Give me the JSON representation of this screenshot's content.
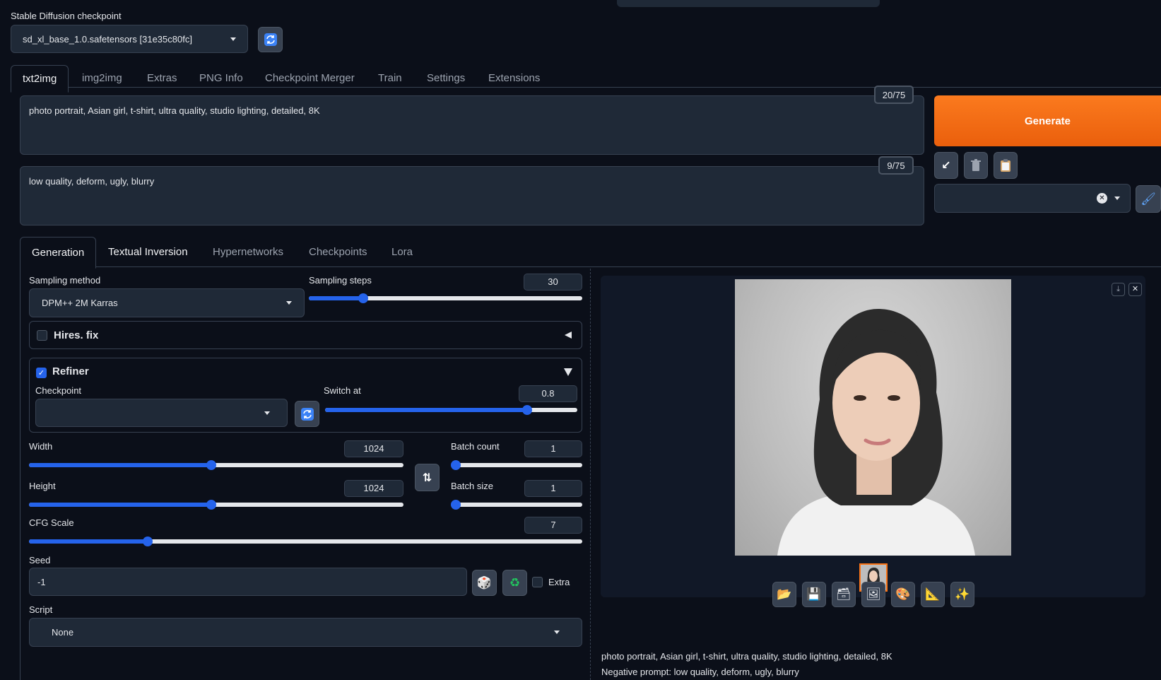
{
  "checkpoint": {
    "label": "Stable Diffusion checkpoint",
    "value": "sd_xl_base_1.0.safetensors [31e35c80fc]"
  },
  "main_tabs": [
    {
      "label": "txt2img",
      "active": true
    },
    {
      "label": "img2img"
    },
    {
      "label": "Extras"
    },
    {
      "label": "PNG Info"
    },
    {
      "label": "Checkpoint Merger"
    },
    {
      "label": "Train"
    },
    {
      "label": "Settings"
    },
    {
      "label": "Extensions"
    }
  ],
  "prompt": {
    "value": "photo portrait, Asian girl, t-shirt, ultra quality, studio lighting, detailed, 8K",
    "token_count": "20/75"
  },
  "negative_prompt": {
    "value": "low quality, deform, ugly, blurry",
    "token_count": "9/75"
  },
  "generate_label": "Generate",
  "sub_tabs": [
    {
      "label": "Generation",
      "active": true
    },
    {
      "label": "Textual Inversion"
    },
    {
      "label": "Hypernetworks"
    },
    {
      "label": "Checkpoints"
    },
    {
      "label": "Lora"
    }
  ],
  "sampling": {
    "method_label": "Sampling method",
    "method_value": "DPM++ 2M Karras",
    "steps_label": "Sampling steps",
    "steps_value": "30",
    "steps_fraction": 0.2
  },
  "hires": {
    "label": "Hires. fix",
    "checked": false
  },
  "refiner": {
    "label": "Refiner",
    "checked": true,
    "checkpoint_label": "Checkpoint",
    "checkpoint_value": "",
    "switch_label": "Switch at",
    "switch_value": "0.8",
    "switch_fraction": 0.8
  },
  "width": {
    "label": "Width",
    "value": "1024",
    "fraction": 0.486
  },
  "height": {
    "label": "Height",
    "value": "1024",
    "fraction": 0.486
  },
  "batch_count": {
    "label": "Batch count",
    "value": "1",
    "fraction": 0
  },
  "batch_size": {
    "label": "Batch size",
    "value": "1",
    "fraction": 0
  },
  "cfg": {
    "label": "CFG Scale",
    "value": "7",
    "fraction": 0.214
  },
  "seed": {
    "label": "Seed",
    "value": "-1",
    "extra_label": "Extra"
  },
  "script": {
    "label": "Script",
    "value": "None"
  },
  "output": {
    "info_prompt": "photo portrait, Asian girl, t-shirt, ultra quality, studio lighting, detailed, 8K",
    "info_negative": "Negative prompt: low quality, deform, ugly, blurry"
  },
  "colors": {
    "accent_orange": "#f97316",
    "accent_blue": "#2563eb",
    "background": "#0b0f19"
  },
  "icons": [
    "refresh-icon",
    "arrow-icon",
    "trash-icon",
    "clipboard-icon",
    "brush-icon",
    "dice-icon",
    "recycle-icon",
    "swap-icon",
    "folder-icon",
    "save-icon",
    "zip-icon",
    "image-icon",
    "palette-icon",
    "ruler-icon",
    "sparkle-icon",
    "download-icon",
    "close-icon"
  ]
}
